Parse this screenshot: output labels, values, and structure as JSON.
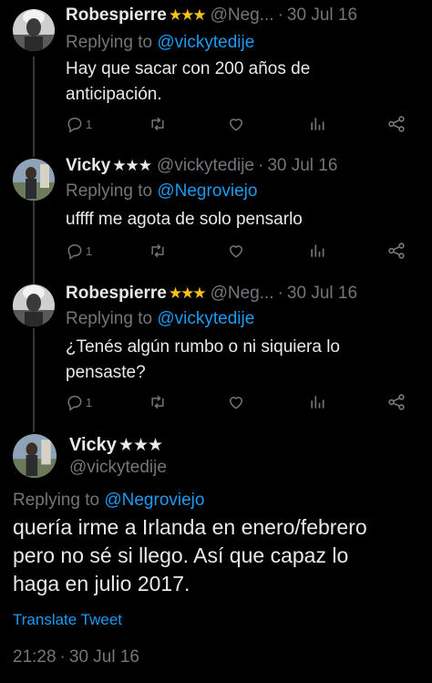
{
  "replies": [
    {
      "name": "Robespierre",
      "stars": "★★★",
      "handle": "@Neg...",
      "time": "30 Jul 16",
      "reply_label": "Replying to",
      "reply_mention": "@vickytedije",
      "text_lines": [
        "Hay que sacar con 200 años de",
        "anticipación."
      ],
      "reply_count": "1"
    },
    {
      "name": "Vicky",
      "stars": "★★★",
      "handle": "@vickytedije",
      "time": "30 Jul 16",
      "reply_label": "Replying to",
      "reply_mention": "@Negroviejo",
      "text_lines": [
        "uffff me agota de solo pensarlo"
      ],
      "reply_count": "1"
    },
    {
      "name": "Robespierre",
      "stars": "★★★",
      "handle": "@Neg...",
      "time": "30 Jul 16",
      "reply_label": "Replying to",
      "reply_mention": "@vickytedije",
      "text_lines": [
        "¿Tenés algún rumbo o ni siquiera lo",
        "pensaste?"
      ],
      "reply_count": "1"
    }
  ],
  "main_tweet": {
    "name": "Vicky",
    "stars": "★★★",
    "handle": "@vickytedije",
    "reply_label": "Replying to",
    "reply_mention": "@Negroviejo",
    "text_lines": [
      "quería irme a Irlanda en enero/febrero",
      "pero no sé si llego. Así que capaz lo",
      "haga en julio 2017."
    ],
    "translate_label": "Translate Tweet",
    "timestamp": "21:28",
    "date": "30 Jul 16"
  },
  "separator": "·",
  "colors": {
    "background": "#000000",
    "text": "#e7e9ea",
    "muted": "#71767b",
    "link": "#1d9bf0",
    "gold_star": "#f4c21b"
  },
  "icons": [
    "reply-icon",
    "retweet-icon",
    "like-icon",
    "views-icon",
    "share-icon"
  ]
}
